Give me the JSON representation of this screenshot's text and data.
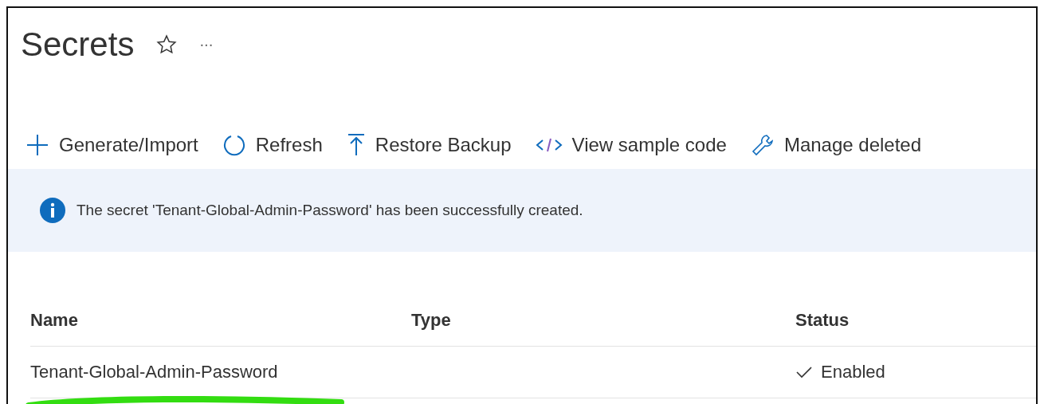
{
  "page": {
    "title": "Secrets",
    "favorite": false,
    "more": "···"
  },
  "toolbar": [
    {
      "kind": "plus",
      "label": "Generate/Import"
    },
    {
      "kind": "refresh",
      "label": "Refresh"
    },
    {
      "kind": "restore",
      "label": "Restore Backup"
    },
    {
      "kind": "code",
      "label": "View sample code"
    },
    {
      "kind": "wrench",
      "label": "Manage deleted"
    }
  ],
  "banner": {
    "message": "The secret 'Tenant-Global-Admin-Password' has been successfully created."
  },
  "table": {
    "columns": [
      "Name",
      "Type",
      "Status"
    ],
    "rows": [
      {
        "name": "Tenant-Global-Admin-Password",
        "status": "Enabled",
        "underlined": true
      }
    ]
  }
}
